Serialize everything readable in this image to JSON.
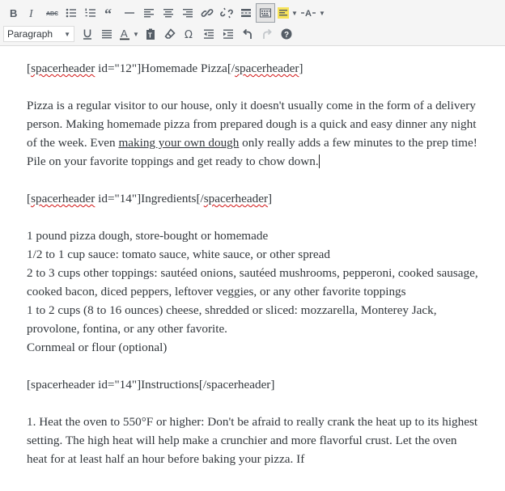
{
  "toolbar": {
    "format_select": "Paragraph",
    "row1_buttons": [
      "bold-icon",
      "italic-icon",
      "strikethrough-icon",
      "bullet-list-icon",
      "numbered-list-icon",
      "blockquote-icon",
      "horizontal-line-icon",
      "align-left-icon",
      "align-center-icon",
      "align-right-icon",
      "link-icon",
      "unlink-icon",
      "read-more-icon",
      "toolbar-toggle-icon",
      "highlight-icon",
      "text-format-icon"
    ],
    "row2_buttons": [
      "underline-icon",
      "justify-icon",
      "text-color-icon",
      "paste-as-text-icon",
      "clear-formatting-icon",
      "special-character-icon",
      "outdent-icon",
      "indent-icon",
      "undo-icon",
      "redo-icon",
      "help-icon"
    ]
  },
  "editor": {
    "h1_open": "[",
    "h1_tag": "spacerheader",
    "h1_mid": " id=\"12\"]Homemade Pizza[/",
    "h1_tag2": "spacerheader",
    "h1_close": "]",
    "intro_part1": "Pizza is a regular visitor to our house, only it doesn't usually come in the form of a delivery person. Making homemade pizza from prepared dough is a quick and easy dinner any night of the week. Even ",
    "intro_link": "making your own dough",
    "intro_part2": " only really adds a few minutes to the prep time! Pile on your favorite toppings and get ready to chow down.",
    "h2_open": "[",
    "h2_tag": "spacerheader",
    "h2_mid": " id=\"14\"]Ingredients[/",
    "h2_tag2": "spacerheader",
    "h2_close": "]",
    "ingredients": [
      "1 pound pizza dough, store-bought or homemade",
      "1/2 to 1 cup sauce: tomato sauce, white sauce, or other spread",
      "2 to 3 cups other toppings: sautéed onions, sautéed mushrooms, pepperoni, cooked sausage, cooked bacon, diced peppers, leftover veggies, or any other favorite toppings",
      "1 to 2 cups (8 to 16 ounces) cheese, shredded or sliced: mozzarella, Monterey Jack, provolone, fontina, or any other favorite.",
      "Cornmeal or flour (optional)"
    ],
    "h3": "[spacerheader id=\"14\"]Instructions[/spacerheader]",
    "step1": "1. Heat the oven to 550°F or higher: Don't be afraid to really crank the heat up to its highest setting. The high heat will help make a crunchier and more flavorful crust. Let the oven heat for at least half an hour before baking your pizza. If"
  }
}
